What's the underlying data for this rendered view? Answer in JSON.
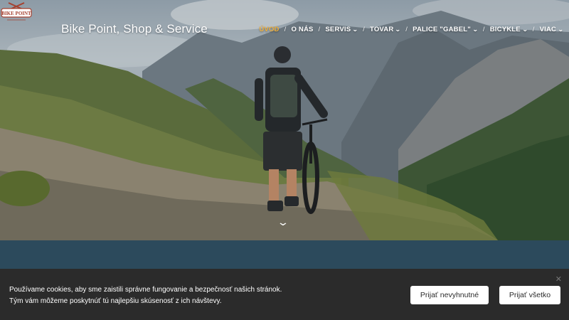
{
  "header": {
    "site_title": "Bike Point, Shop & Service",
    "logo_text": "BIKE POINT",
    "nav": [
      {
        "label": "ÚVOD",
        "active": true,
        "dropdown": false
      },
      {
        "label": "O NÁS",
        "active": false,
        "dropdown": false
      },
      {
        "label": "SERVIS",
        "active": false,
        "dropdown": true
      },
      {
        "label": "TOVAR",
        "active": false,
        "dropdown": true
      },
      {
        "label": "PALICE \"GABEL\"",
        "active": false,
        "dropdown": true
      },
      {
        "label": "BICYKLE",
        "active": false,
        "dropdown": true
      },
      {
        "label": "VIAC",
        "active": false,
        "dropdown": true
      }
    ],
    "active_color": "#f0b03a"
  },
  "hero": {
    "scroll_icon": "chevron-down-icon"
  },
  "cookie_bar": {
    "text": "Používame cookies, aby sme zaistili správne fungovanie a bezpečnosť našich stránok. Tým vám môžeme poskytnúť tú najlepšiu skúsenosť z ich návštevy.",
    "necessary_label": "Prijať nevyhnutné",
    "accept_all_label": "Prijať všetko",
    "close_icon": "close-icon",
    "background": "#2b2b2b"
  },
  "colors": {
    "band": "#2c4a5c"
  }
}
